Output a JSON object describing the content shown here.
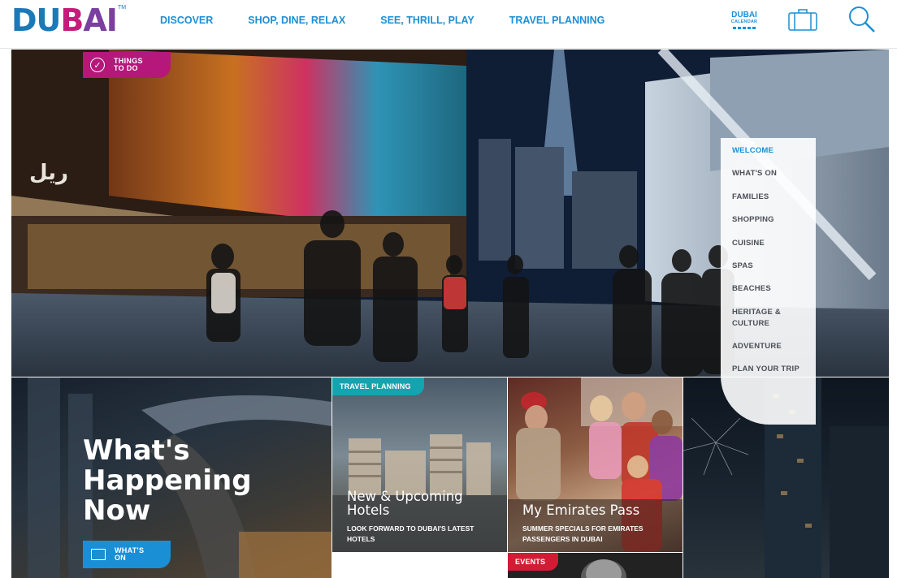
{
  "header": {
    "logo": {
      "part1": "DU",
      "part2": "B",
      "part3": "AI",
      "tm": "TM"
    },
    "nav": [
      "DISCOVER",
      "SHOP, DINE, RELAX",
      "SEE, THRILL, PLAY",
      "TRAVEL PLANNING"
    ],
    "calendar": {
      "line1": "DUBAI",
      "line2": "CALENDAR"
    }
  },
  "hero": {
    "badge": {
      "line1": "THINGS",
      "line2": "TO DO"
    },
    "sign_text": "ريل"
  },
  "side_menu": {
    "items": [
      "WELCOME",
      "WHAT'S ON",
      "FAMILIES",
      "SHOPPING",
      "CUISINE",
      "SPAS",
      "BEACHES",
      "HERITAGE &",
      "CULTURE",
      "ADVENTURE",
      "PLAN YOUR TRIP"
    ],
    "active": "WELCOME"
  },
  "happening": {
    "line1": "What's",
    "line2": "Happening",
    "line3": "Now",
    "button": {
      "line1": "WHAT'S",
      "line2": "ON"
    }
  },
  "tiles": {
    "hotels": {
      "tag": "TRAVEL PLANNING",
      "title1": "New & Upcoming",
      "title2": "Hotels",
      "sub1": "LOOK FORWARD TO DUBAI'S LATEST",
      "sub2": "HOTELS"
    },
    "emirates": {
      "title": "My Emirates Pass",
      "sub1": "SUMMER SPECIALS FOR EMIRATES",
      "sub2": "PASSENGERS IN DUBAI"
    },
    "events": {
      "tag": "EVENTS"
    }
  },
  "colors": {
    "brand_blue": "#1b8fd6",
    "magenta": "#b5177a",
    "teal": "#15a3b0",
    "red": "#d21c35"
  }
}
